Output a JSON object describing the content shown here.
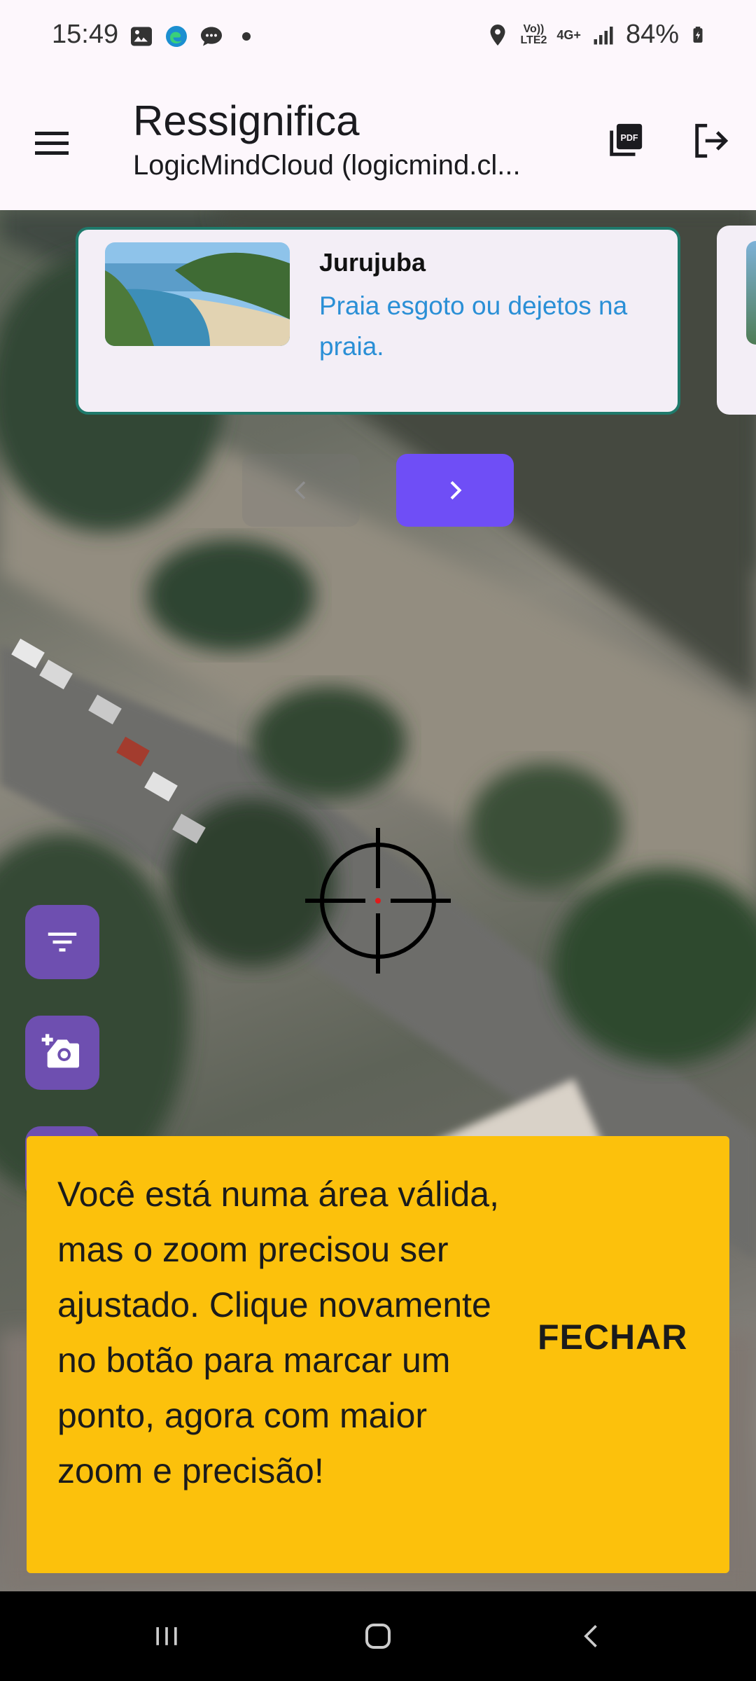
{
  "status_bar": {
    "time": "15:49",
    "network_label_top": "Vo))",
    "network_label_bottom": "LTE2",
    "network_type": "4G+",
    "battery": "84%"
  },
  "app_bar": {
    "title": "Ressignifica",
    "subtitle": "LogicMindCloud (logicmind.cl..."
  },
  "card": {
    "title": "Jurujuba",
    "description": "Praia esgoto ou dejetos na praia."
  },
  "snackbar": {
    "message": "Você está numa área válida, mas o zoom precisou ser ajustado. Clique novamente no botão para marcar um ponto, agora com maior zoom e precisão!",
    "action": "FECHAR"
  },
  "colors": {
    "primary": "#6f4ef6",
    "fab": "#6e4fb0",
    "snackbar": "#fcc10c",
    "card_border": "#1f7a6b",
    "link": "#2a8fd6"
  },
  "icons": {
    "menu": "menu-icon",
    "pdf": "pdf-icon",
    "logout": "logout-icon",
    "filter": "filter-icon",
    "camera": "add-photo-icon",
    "prev": "chevron-left-icon",
    "next": "chevron-right-icon"
  }
}
